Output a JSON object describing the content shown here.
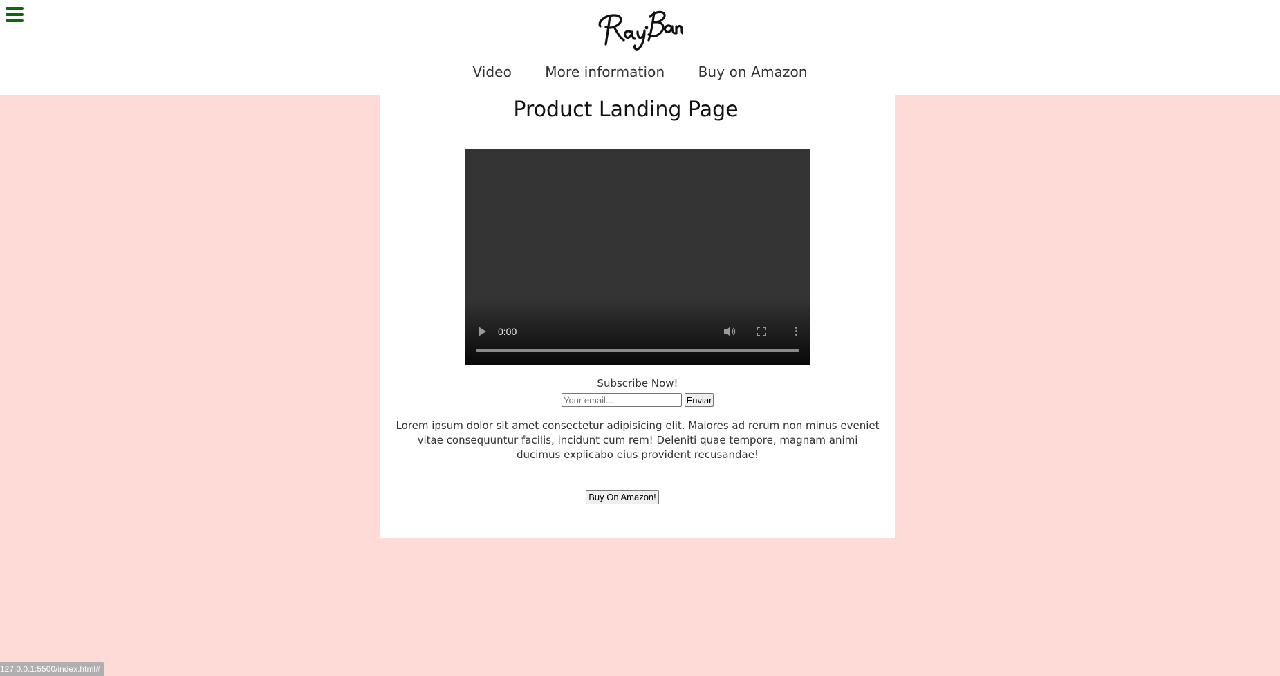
{
  "header": {
    "menu_icon": "hamburger-menu-icon",
    "menu_icon_color": "#0b6b0b",
    "logo_text": "Ray-Ban",
    "nav": [
      {
        "label": "Video"
      },
      {
        "label": "More information"
      },
      {
        "label": "Buy on Amazon"
      }
    ]
  },
  "main": {
    "title": "Product Landing Page",
    "video": {
      "time": "0:00",
      "controls": [
        "play-icon",
        "volume-icon",
        "fullscreen-icon",
        "more-options-icon"
      ]
    },
    "subscribe": {
      "label": "Subscribe Now!",
      "placeholder": "Your email...",
      "button_label": "Enviar"
    },
    "description": "Lorem ipsum dolor sit amet consectetur adipisicing elit. Maiores ad rerum non minus eveniet vitae consequuntur facilis, incidunt cum rem! Deleniti quae tempore, magnam animi ducimus explicabo eius provident recusandae!",
    "buy_button_label": "Buy On Amazon!"
  },
  "status_bar": {
    "url": "127.0.0.1:5500/index.html#"
  },
  "colors": {
    "page_background": "#ffdbd7",
    "card_background": "#ffffff",
    "video_background": "#333333"
  }
}
